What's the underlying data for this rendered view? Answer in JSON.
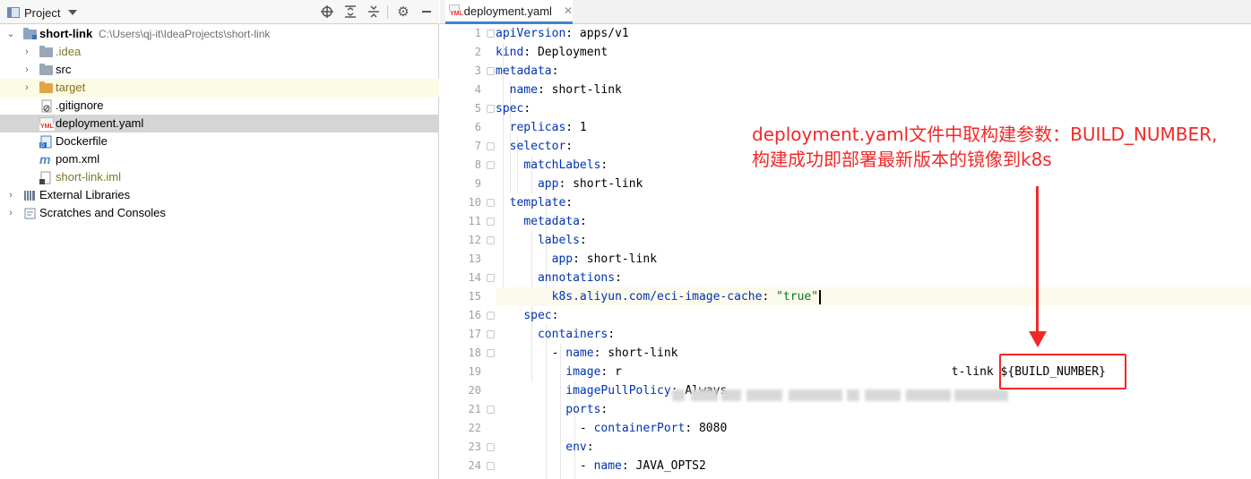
{
  "project_panel": {
    "title": "Project",
    "tree": [
      {
        "label": "short-link",
        "path": "C:\\Users\\qj-it\\IdeaProjects\\short-link"
      },
      {
        "label": ".idea"
      },
      {
        "label": "src"
      },
      {
        "label": "target"
      },
      {
        "label": ".gitignore"
      },
      {
        "label": "deployment.yaml"
      },
      {
        "label": "Dockerfile"
      },
      {
        "label": "pom.xml"
      },
      {
        "label": "short-link.iml"
      },
      {
        "label": "External Libraries"
      },
      {
        "label": "Scratches and Consoles"
      }
    ]
  },
  "editor": {
    "tab_label": "deployment.yaml",
    "line_numbers": [
      "1",
      "2",
      "3",
      "4",
      "5",
      "6",
      "7",
      "8",
      "9",
      "10",
      "11",
      "12",
      "13",
      "14",
      "15",
      "16",
      "17",
      "18",
      "19",
      "20",
      "21",
      "22",
      "23",
      "24"
    ],
    "lines": {
      "l1_key": "apiVersion",
      "l1_val": ": apps/v1",
      "l2_key": "kind",
      "l2_val": ": Deployment",
      "l3_key": "metadata",
      "l3_val": ":",
      "l4_key": "name",
      "l4_val": ": short-link",
      "l5_key": "spec",
      "l5_val": ":",
      "l6_key": "replicas",
      "l6_val": ": 1",
      "l7_key": "selector",
      "l7_val": ":",
      "l8_key": "matchLabels",
      "l8_val": ":",
      "l9_key": "app",
      "l9_val": ": short-link",
      "l10_key": "template",
      "l10_val": ":",
      "l11_key": "metadata",
      "l11_val": ":",
      "l12_key": "labels",
      "l12_val": ":",
      "l13_key": "app",
      "l13_val": ": short-link",
      "l14_key": "annotations",
      "l14_val": ":",
      "l15_key": "k8s.aliyun.com/eci-image-cache",
      "l15_colon": ": ",
      "l15_str": "\"true\"",
      "l16_key": "spec",
      "l16_val": ":",
      "l17_key": "containers",
      "l17_val": ":",
      "l18_dash": "- ",
      "l18_key": "name",
      "l18_val": ": short-link",
      "l19_key": "image",
      "l19_val": ": r",
      "l19_tail": "t-link ${BUILD_NUMBER}",
      "l20_key": "imagePullPolicy",
      "l20_val": ": Always",
      "l21_key": "ports",
      "l21_val": ":",
      "l22_dash": "- ",
      "l22_key": "containerPort",
      "l22_val": ": 8080",
      "l23_key": "env",
      "l23_val": ":",
      "l24_dash": "- ",
      "l24_key": "name",
      "l24_val": ": JAVA_OPTS2"
    }
  },
  "annotation": {
    "line1": "deployment.yaml文件中取构建参数：BUILD_NUMBER,",
    "line2": "构建成功即部署最新版本的镜像到k8s",
    "color": "#f22828"
  },
  "colors": {
    "keyword": "#0033b3",
    "string": "#067d17",
    "selection": "#d5d5d5",
    "accent": "#4083c9"
  }
}
